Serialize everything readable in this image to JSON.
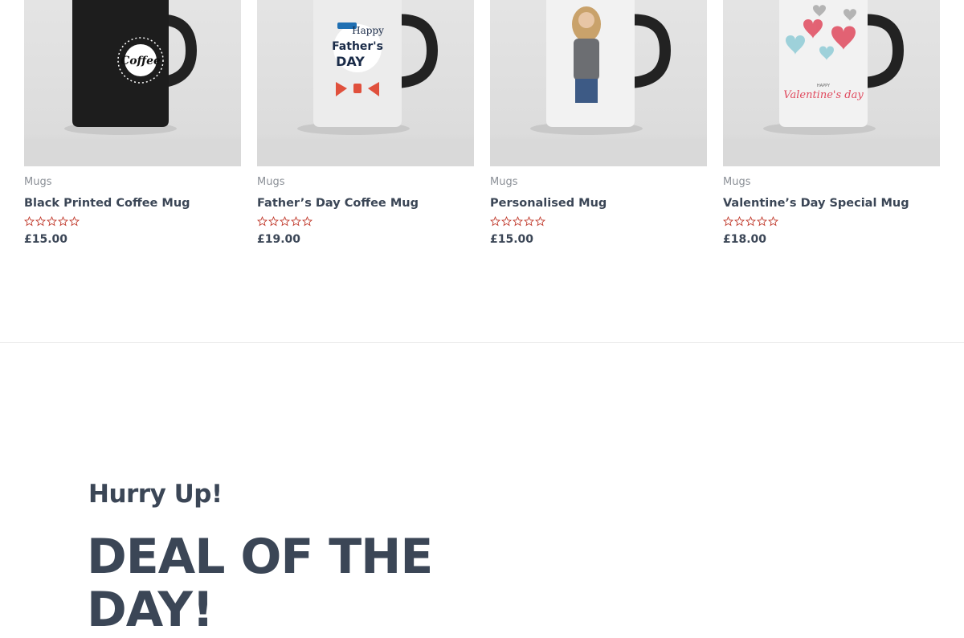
{
  "products": [
    {
      "category": "Mugs",
      "title": "Black Printed Coffee Mug",
      "price": "£15.00",
      "rating": 0,
      "image": "black-coffee-mug-image",
      "mug_text": "Coffee"
    },
    {
      "category": "Mugs",
      "title": "Father’s Day Coffee Mug",
      "price": "£19.00",
      "rating": 0,
      "image": "fathers-day-mug-image",
      "mug_text_1": "Happy",
      "mug_text_2": "Father's",
      "mug_text_3": "DAY"
    },
    {
      "category": "Mugs",
      "title": "Personalised Mug",
      "price": "£15.00",
      "rating": 0,
      "image": "personalised-mug-image"
    },
    {
      "category": "Mugs",
      "title": "Valentine’s Day Special Mug",
      "price": "£18.00",
      "rating": 0,
      "image": "valentines-mug-image",
      "mug_text": "Valentine's day",
      "mug_small": "HAPPY"
    }
  ],
  "deal": {
    "subtitle": "Hurry Up!",
    "heading": "DEAL OF THE DAY!"
  },
  "colors": {
    "text": "#3b4656",
    "category": "#8a8f96",
    "star": "#c0392b",
    "divider": "#e8e8e8"
  }
}
